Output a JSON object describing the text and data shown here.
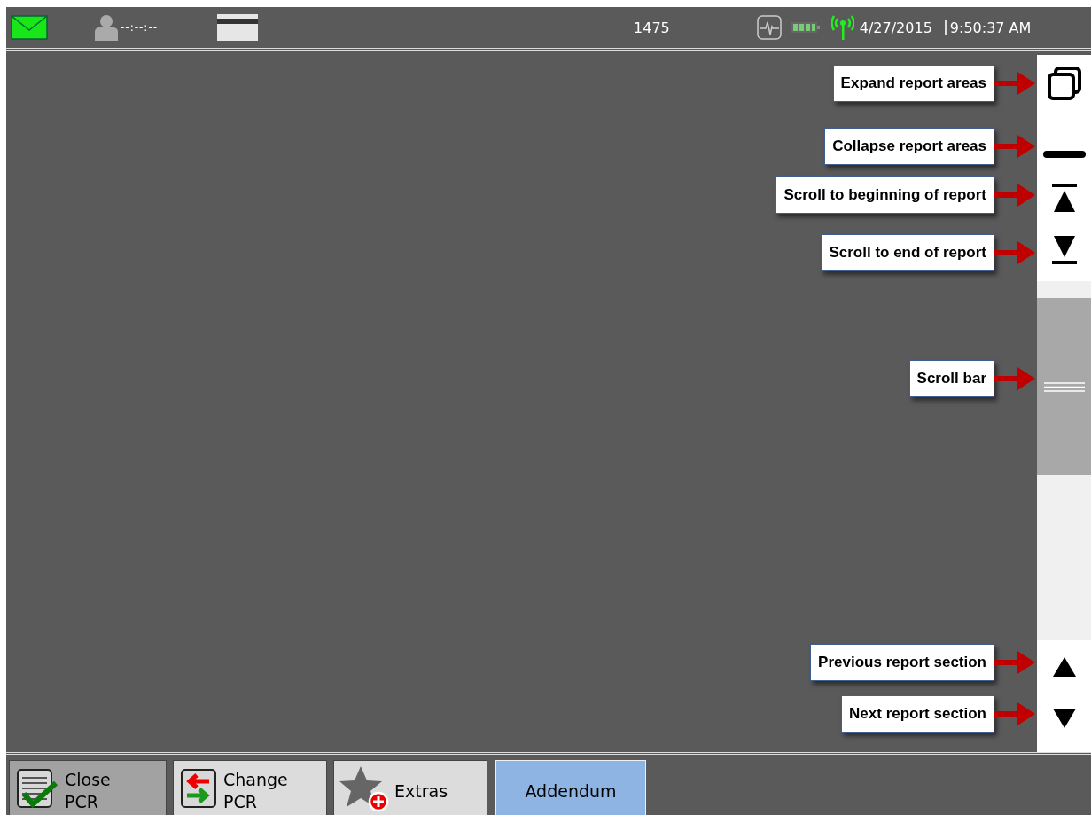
{
  "status_bar": {
    "timer": "--:--:--",
    "unit_number": "1475",
    "date": "4/27/2015",
    "time": "9:50:37 AM"
  },
  "callouts": [
    {
      "label": "Expand report areas"
    },
    {
      "label": "Collapse report areas"
    },
    {
      "label": "Scroll to beginning of report"
    },
    {
      "label": "Scroll to end of report"
    },
    {
      "label": "Scroll bar"
    },
    {
      "label": "Previous report section"
    },
    {
      "label": "Next report section"
    }
  ],
  "bottom_buttons": [
    {
      "kind": "close",
      "lines": [
        "Close",
        "PCR"
      ],
      "disabled": true,
      "selected": false
    },
    {
      "kind": "change",
      "lines": [
        "Change",
        "PCR"
      ],
      "disabled": false,
      "selected": false
    },
    {
      "kind": "extras",
      "lines": [
        "Extras"
      ],
      "disabled": false,
      "selected": false
    },
    {
      "kind": "text",
      "lines": [
        "Addendum"
      ],
      "disabled": false,
      "selected": true
    }
  ]
}
